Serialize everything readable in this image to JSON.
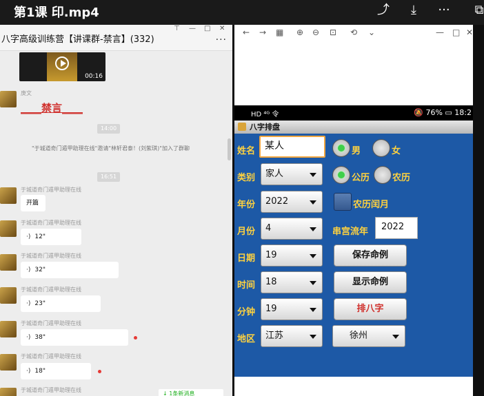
{
  "video_bar": {
    "title": "第1课 印.mp4",
    "icons": [
      "share-icon",
      "download-icon",
      "more-icon",
      "open-external-icon"
    ]
  },
  "chat": {
    "header": {
      "title": "八字高级训练营【讲课群-禁言】(332)",
      "more": "···"
    },
    "video_duration": "00:16",
    "sender1": "庚文",
    "banned_text": "____禁言____",
    "time1": "14:00",
    "system_message": "\"于城道奇门遁甲助理在线\"邀请\"林轩君泰！(刘紫琪)\"加入了群聊",
    "time2": "16:51",
    "messages": [
      {
        "sender": "于城道奇门遁甲助理在线",
        "text": "开篇",
        "type": "text"
      },
      {
        "sender": "于城道奇门遁甲助理在线",
        "text": "12\"",
        "type": "voice"
      },
      {
        "sender": "于城道奇门遁甲助理在线",
        "text": "32\"",
        "type": "voice"
      },
      {
        "sender": "于城道奇门遁甲助理在线",
        "text": "23\"",
        "type": "voice"
      },
      {
        "sender": "于城道奇门遁甲助理在线",
        "text": "38\"",
        "type": "voice"
      },
      {
        "sender": "于城道奇门遁甲助理在线",
        "text": "18\"",
        "type": "voice"
      },
      {
        "sender": "于城道奇门遁甲助理在线",
        "text": "",
        "type": "text"
      }
    ],
    "new_messages": "↓ 1条新消息"
  },
  "viewer": {
    "status": {
      "left": "HD ⁴ᴳ 令",
      "right": "🔕 76% ▭ 18:2"
    },
    "app_title": "八字排盘",
    "form": {
      "name_label": "姓名",
      "name_value": "某人",
      "gender_male": "男",
      "gender_female": "女",
      "category_label": "类别",
      "category_value": "家人",
      "cal_solar": "公历",
      "cal_lunar": "农历",
      "year_label": "年份",
      "year_value": "2022",
      "leap_month": "农历闰月",
      "month_label": "月份",
      "month_value": "4",
      "flow_year_label": "串宫流年",
      "flow_year_value": "2022",
      "day_label": "日期",
      "day_value": "19",
      "hour_label": "时间",
      "hour_value": "18",
      "minute_label": "分钟",
      "minute_value": "19",
      "region_label": "地区",
      "province_value": "江苏",
      "city_value": "徐州",
      "save_button": "保存命例",
      "show_button": "显示命例",
      "paipan_button": "排八字"
    }
  }
}
